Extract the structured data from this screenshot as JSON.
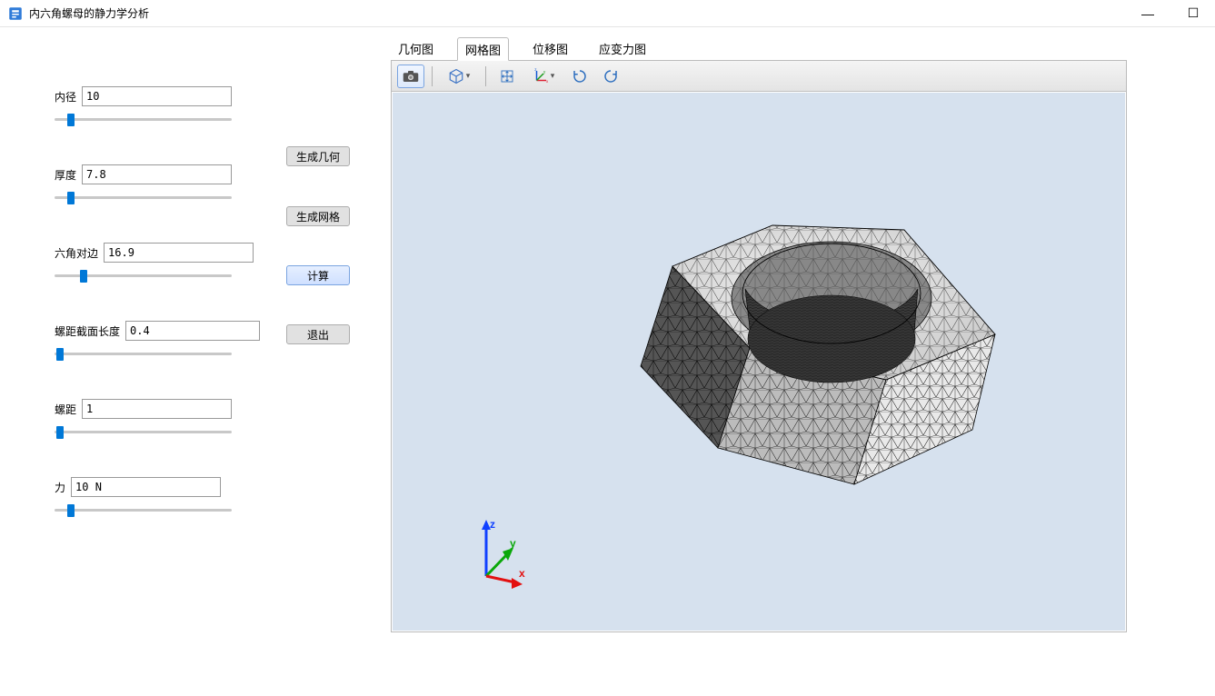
{
  "window": {
    "title": "内六角螺母的静力学分析",
    "minimize": "—",
    "maximize": "☐",
    "close_hidden": ""
  },
  "params": {
    "inner_diameter": {
      "label": "内径",
      "value": "10"
    },
    "thickness": {
      "label": "厚度",
      "value": "7.8"
    },
    "hex_af": {
      "label": "六角对边",
      "value": "16.9"
    },
    "pitch_section": {
      "label": "螺距截面长度",
      "value": "0.4"
    },
    "pitch": {
      "label": "螺距",
      "value": "1"
    },
    "force": {
      "label": "力",
      "value": "10 N"
    }
  },
  "buttons": {
    "geometry": "生成几何",
    "mesh": "生成网格",
    "compute": "计算",
    "exit": "退出"
  },
  "tabs": {
    "geometry": "几何图",
    "mesh": "网格图",
    "disp": "位移图",
    "stress": "应变力图",
    "active": "mesh"
  },
  "axis_labels": {
    "x": "x",
    "y": "y",
    "z": "z"
  },
  "toolbar_icons": {
    "camera": "camera-icon",
    "cube": "cube-icon",
    "move": "move-icon",
    "axes": "axes-icon",
    "rotate_cw": "rotate-cw-icon",
    "rotate_ccw": "rotate-ccw-icon"
  }
}
